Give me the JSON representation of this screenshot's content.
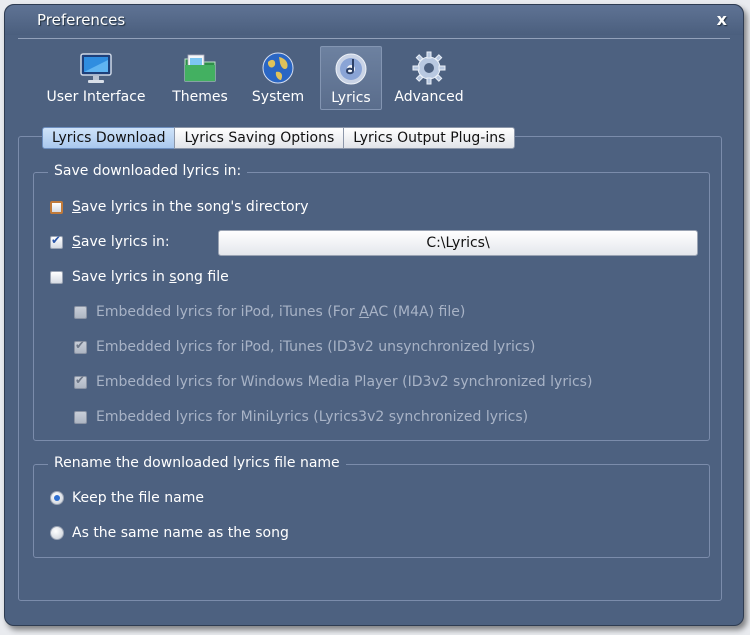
{
  "window": {
    "title": "Preferences",
    "close_label": "x"
  },
  "toolbar": {
    "items": [
      {
        "label": "User Interface",
        "icon": "monitor-icon"
      },
      {
        "label": "Themes",
        "icon": "folder-icon"
      },
      {
        "label": "System",
        "icon": "globe-icon"
      },
      {
        "label": "Lyrics",
        "icon": "lyrics-disc-icon",
        "active": true
      },
      {
        "label": "Advanced",
        "icon": "gear-icon"
      }
    ]
  },
  "tabs": [
    {
      "label": "Lyrics Download",
      "active": true
    },
    {
      "label": "Lyrics Saving Options"
    },
    {
      "label": "Lyrics Output Plug-ins"
    }
  ],
  "save_group": {
    "legend": "Save downloaded lyrics in:",
    "song_directory": {
      "prefix": "S",
      "rest": "ave lyrics in the song's directory",
      "checked": false
    },
    "save_in": {
      "prefix": "S",
      "rest": "ave lyrics in:",
      "checked": true,
      "path": "C:\\Lyrics\\"
    },
    "song_file": {
      "pre": "Save lyrics in ",
      "ul": "s",
      "rest": "ong file",
      "checked": false
    },
    "embedded": [
      {
        "pre": "Embedded lyrics for iPod, iTunes (For ",
        "ul": "A",
        "rest": "AC (M4A) file)",
        "checked": false
      },
      {
        "pre": "Embedded lyrics for iPod, iTunes (ID3v2 unsynchronized lyrics)",
        "ul": "",
        "rest": "",
        "checked": true
      },
      {
        "pre": "Embedded lyrics for Windows Media Player (ID3v2 synchronized lyrics)",
        "ul": "",
        "rest": "",
        "checked": true
      },
      {
        "pre": "Embedded lyrics for MiniLyrics (Lyrics3v2 synchronized lyrics)",
        "ul": "",
        "rest": "",
        "checked": false
      }
    ]
  },
  "rename_group": {
    "legend": "Rename the downloaded lyrics file name",
    "options": [
      {
        "label": "Keep the file name",
        "selected": true
      },
      {
        "label": "As the same name as the song",
        "selected": false
      }
    ]
  },
  "colors": {
    "window_bg": "#4d6180",
    "accent": "#2f6fd1",
    "focus_border": "#c07a3a"
  }
}
